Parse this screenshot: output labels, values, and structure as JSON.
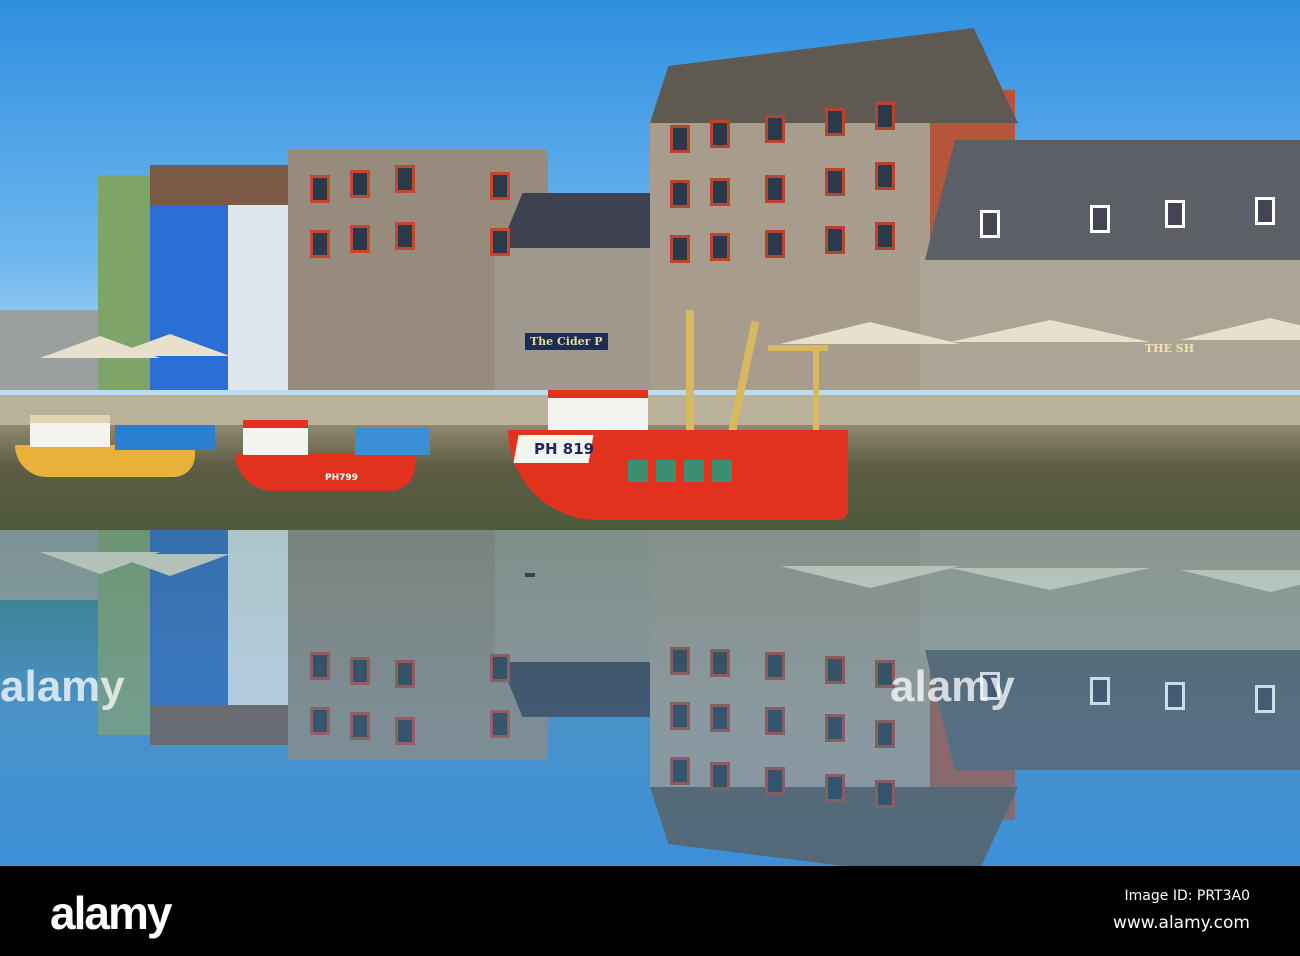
{
  "scene": {
    "pub_sign": "The Cider P",
    "right_pub_sign": "THE SH",
    "boat_large_registration": "PH 819",
    "boat_small_registration": "PH799",
    "colors": {
      "sky": "#2f8fe0",
      "water": "#3d8fd8",
      "boat_red": "#e2321e",
      "stone": "#9a8f80"
    }
  },
  "watermark": {
    "text": "alamy"
  },
  "footer": {
    "logo": "alamy",
    "image_id": "Image ID: PRT3A0",
    "website": "www.alamy.com"
  }
}
